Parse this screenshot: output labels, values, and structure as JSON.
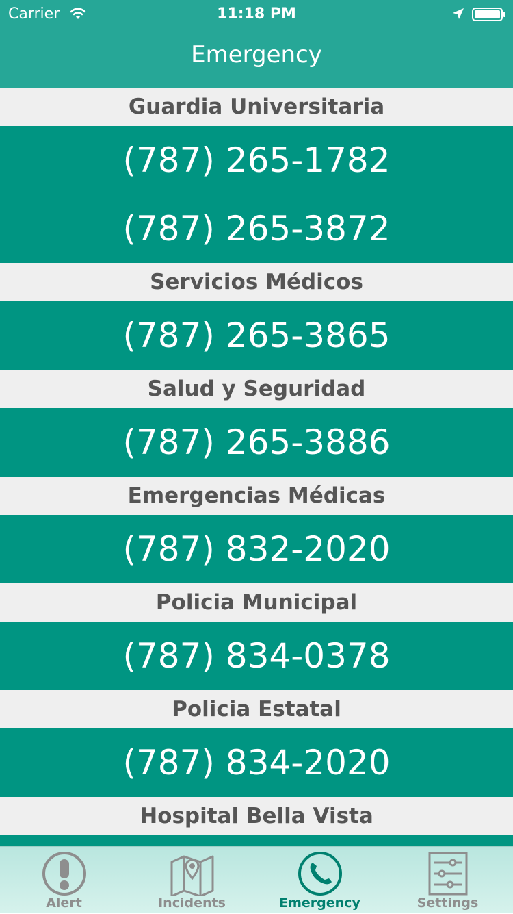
{
  "status_bar": {
    "carrier": "Carrier",
    "time": "11:18 PM",
    "icons": [
      "wifi-icon",
      "location-arrow-icon",
      "battery-icon"
    ]
  },
  "nav": {
    "title": "Emergency"
  },
  "sections": [
    {
      "title": "Guardia Universitaria",
      "phones": [
        "(787) 265-1782",
        "(787) 265-3872"
      ]
    },
    {
      "title": "Servicios Médicos",
      "phones": [
        "(787) 265-3865"
      ]
    },
    {
      "title": "Salud y Seguridad",
      "phones": [
        "(787) 265-3886"
      ]
    },
    {
      "title": "Emergencias Médicas",
      "phones": [
        "(787) 832-2020"
      ]
    },
    {
      "title": "Policia Municipal",
      "phones": [
        "(787) 834-0378"
      ]
    },
    {
      "title": "Policia Estatal",
      "phones": [
        "(787) 834-2020"
      ]
    },
    {
      "title": "Hospital Bella Vista",
      "phones": []
    }
  ],
  "tabs": [
    {
      "label": "Alert",
      "icon": "exclamation-circle-icon",
      "active": false
    },
    {
      "label": "Incidents",
      "icon": "map-pin-icon",
      "active": false
    },
    {
      "label": "Emergency",
      "icon": "phone-circle-icon",
      "active": true
    },
    {
      "label": "Settings",
      "icon": "sliders-icon",
      "active": false
    }
  ],
  "colors": {
    "accent": "#26a797",
    "row_background": "#009582",
    "section_background": "#efefef",
    "section_text": "#555555",
    "tab_inactive": "#8e8e8e",
    "tab_active": "#00806f"
  }
}
